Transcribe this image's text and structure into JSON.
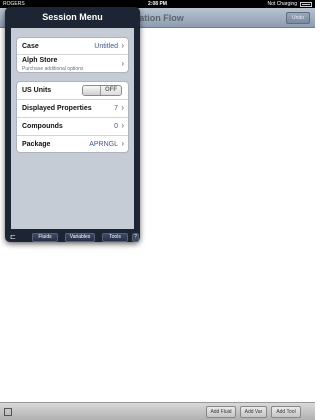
{
  "status_bar": {
    "carrier": "ROGERS",
    "time": "2:08 PM",
    "battery_text": "Not Charging"
  },
  "navbar": {
    "title": "mation Flow",
    "undo_label": "Undo"
  },
  "session_menu": {
    "title": "Session Menu",
    "group1": {
      "case": {
        "label": "Case",
        "value": "Untitled"
      },
      "alph_store": {
        "label": "Alph Store",
        "subtitle": "Purchase additional options"
      }
    },
    "group2": {
      "us_units": {
        "label": "US Units",
        "toggle": "OFF"
      },
      "displayed_properties": {
        "label": "Displayed Properties",
        "value": "7"
      },
      "compounds": {
        "label": "Compounds",
        "value": "0"
      },
      "package": {
        "label": "Package",
        "value": "APRNGL"
      }
    },
    "toolbar": {
      "fluids": "Fluids",
      "variables": "Variables",
      "tools": "Tools",
      "help": "?"
    }
  },
  "bottom_bar": {
    "add_fluid": "Add Fluid",
    "add_var": "Add Var",
    "add_tool": "Add Tool"
  },
  "icons": {
    "chevron": "›",
    "wifi": "wifi-icon",
    "battery": "battery-icon"
  }
}
